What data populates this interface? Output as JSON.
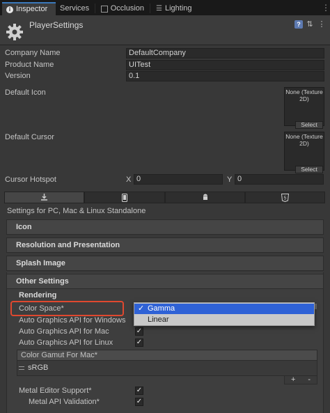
{
  "tabs": [
    {
      "label": "Inspector",
      "icon": "info-icon"
    },
    {
      "label": "Services",
      "icon": ""
    },
    {
      "label": "Occlusion",
      "icon": "occlusion-icon"
    },
    {
      "label": "Lighting",
      "icon": "lighting-icon"
    }
  ],
  "header": {
    "title": "PlayerSettings"
  },
  "fields": {
    "company_name": {
      "label": "Company Name",
      "value": "DefaultCompany"
    },
    "product_name": {
      "label": "Product Name",
      "value": "UITest"
    },
    "version": {
      "label": "Version",
      "value": "0.1"
    }
  },
  "default_icon": {
    "label": "Default Icon",
    "texture": "None (Texture 2D)",
    "select": "Select"
  },
  "default_cursor": {
    "label": "Default Cursor",
    "texture": "None (Texture 2D)",
    "select": "Select"
  },
  "cursor_hotspot": {
    "label": "Cursor Hotspot",
    "x_label": "X",
    "x_value": "0",
    "y_label": "Y",
    "y_value": "0"
  },
  "platform_tabs": [
    "standalone-icon",
    "ios-icon",
    "android-icon",
    "webgl-icon"
  ],
  "webgl_badge": "5",
  "settings_for": "Settings for PC, Mac & Linux Standalone",
  "sections": {
    "icon": "Icon",
    "resolution": "Resolution and Presentation",
    "splash": "Splash Image",
    "other": "Other Settings"
  },
  "other_settings": {
    "rendering": "Rendering",
    "color_space": "Color Space*",
    "auto_api_windows": "Auto Graphics API  for Windows",
    "auto_api_mac": "Auto Graphics API  for Mac",
    "auto_api_linux": "Auto Graphics API  for Linux",
    "color_gamut_header": "Color Gamut For Mac*",
    "color_gamut_item": "sRGB",
    "add": "+",
    "remove": "-",
    "metal_editor_support": "Metal Editor Support*",
    "metal_api_validation": "Metal API Validation*"
  },
  "checks": {
    "mark": "✓"
  },
  "popup": {
    "options": [
      "Gamma",
      "Linear"
    ],
    "selected": "Gamma",
    "check": "✓"
  },
  "colors": {
    "selection": "#2f62d6",
    "highlight": "#e0482f",
    "accent": "#3a79bb"
  }
}
